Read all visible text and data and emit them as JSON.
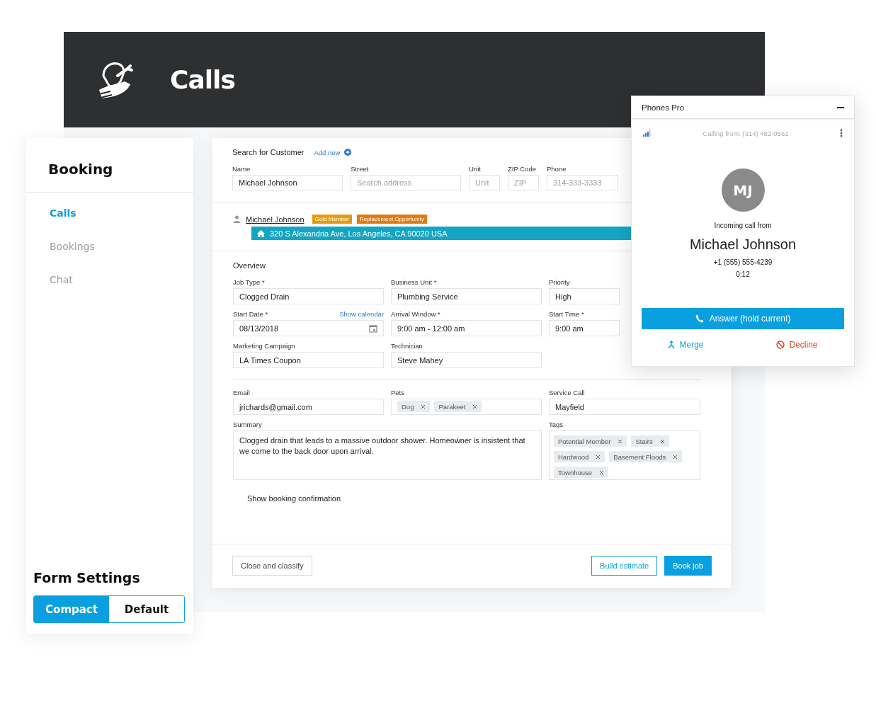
{
  "header": {
    "title": "Calls"
  },
  "sidebar": {
    "title": "Booking",
    "items": [
      {
        "label": "Calls",
        "selected": true
      },
      {
        "label": "Bookings",
        "selected": false
      },
      {
        "label": "Chat",
        "selected": false
      }
    ],
    "settings_title": "Form Settings",
    "modes": [
      {
        "label": "Compact",
        "selected": true
      },
      {
        "label": "Default",
        "selected": false
      }
    ]
  },
  "search": {
    "title": "Search for Customer",
    "add_new": "Add new",
    "fields": [
      {
        "label": "Name",
        "value": "Michael Johnson"
      },
      {
        "label": "Street",
        "placeholder": "Search address"
      },
      {
        "label": "Unit",
        "placeholder": "Unit"
      },
      {
        "label": "ZIP Code",
        "placeholder": "ZIP"
      },
      {
        "label": "Phone",
        "placeholder": "314-333-3333"
      }
    ]
  },
  "customer": {
    "name": "Michael Johnson",
    "tags": [
      {
        "label": "Gold Member",
        "color": "#e49b0f"
      },
      {
        "label": "Replacement Opportunity",
        "color": "#e27a12"
      }
    ],
    "address": "320 S Alexandria Ave, Los Angeles, CA 90020 USA"
  },
  "overview": {
    "title": "Overview",
    "fields": [
      {
        "kind": "text",
        "label": "Job Type *",
        "value": "Clogged Drain"
      },
      {
        "kind": "text",
        "label": "Business Unit *",
        "value": "Plumbing Service"
      },
      {
        "kind": "text",
        "label": "Priority",
        "value": "High"
      },
      {
        "kind": "date",
        "label": "Start Date *",
        "link": "Show calendar",
        "value": "08/13/2018"
      },
      {
        "kind": "text",
        "label": "Arrival Window *",
        "value": "9:00 am - 12:00 am"
      },
      {
        "kind": "text",
        "label": "Start Time *",
        "value": "9:00 am"
      },
      {
        "kind": "text",
        "label": "Marketing Campaign",
        "value": "LA Times Coupon"
      },
      {
        "kind": "text",
        "label": "Technician",
        "value": "Steve Mahey"
      }
    ]
  },
  "details": {
    "email": {
      "label": "Email",
      "value": "jrichards@gmail.com"
    },
    "pets": {
      "label": "Pets",
      "chips": [
        "Dog",
        "Parakeet"
      ]
    },
    "service_call": {
      "label": "Service Call",
      "value": "Mayfield"
    },
    "summary": {
      "label": "Summary",
      "value": "Clogged drain that leads to a massive outdoor shower. Homeowner is insistent that we come to the back door upon arrival."
    },
    "tags": {
      "label": "Tags",
      "chips": [
        "Potential Member",
        "Stairs",
        "Hardwood",
        "Basement Floods",
        "Townhouse"
      ]
    }
  },
  "confirmation": "Show booking confirmation",
  "footer_buttons": [
    {
      "kind": "secondary",
      "label": "Close and classify"
    },
    {
      "kind": "outline",
      "label": "Build estimate"
    },
    {
      "kind": "primary",
      "label": "Book job"
    }
  ],
  "phone": {
    "title": "Phones Pro",
    "calling_from": "Calling from: (314) 482-0561",
    "initials": "MJ",
    "incoming": "Incoming call from",
    "caller": "Michael Johnson",
    "number": "+1 (555) 555-4239",
    "duration": "0:12",
    "answer": "Answer (hold current)",
    "merge": "Merge",
    "decline": "Decline"
  }
}
